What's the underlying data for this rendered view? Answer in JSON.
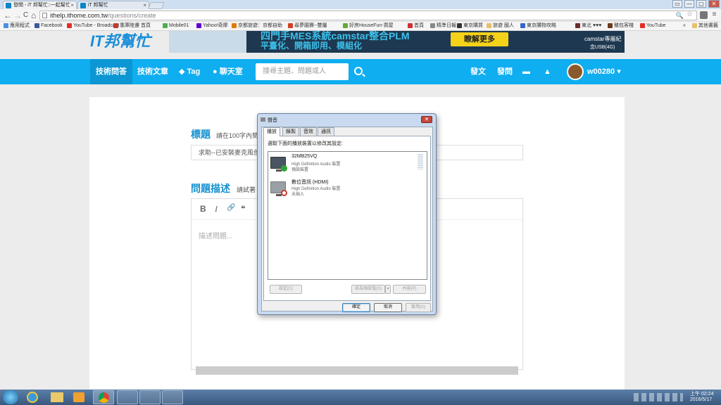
{
  "browser": {
    "tabs": [
      {
        "label": "發問 - iT 邦幫忙::一起幫忙",
        "close": "×"
      },
      {
        "label": "iT 邦幫忙",
        "close": "×"
      }
    ],
    "window_buttons": [
      "▭",
      "—",
      "▢",
      "✕"
    ],
    "nav": {
      "back": "←",
      "forward": "→",
      "reload": "C",
      "home": "⌂"
    },
    "address": {
      "host": "ithelp.ithome.com.tw",
      "path": "/questions/create",
      "zoom": "🔍",
      "star": "☆"
    },
    "menu": "≡",
    "bookmarks": [
      {
        "label": "應用程式",
        "color": "#4a90e2"
      },
      {
        "label": "Facebook",
        "color": "#3b5998"
      },
      {
        "label": "YouTube - Broadcast",
        "color": "#e52d27"
      },
      {
        "label": "重庫陸遷 首頁",
        "color": "#c23a2c"
      },
      {
        "label": "Mobile01",
        "color": "#4caf50"
      },
      {
        "label": "Yahoo!奇摩",
        "color": "#5f01d1"
      },
      {
        "label": "京都旅遊：京都自助",
        "color": "#e07b00"
      },
      {
        "label": "尋夢園賽--雙屬",
        "color": "#d04020"
      },
      {
        "label": "好房HouseFun-買屋",
        "color": "#66aa33"
      },
      {
        "label": "首頁",
        "color": "#d32f2f"
      },
      {
        "label": "精準日報",
        "color": "#888888"
      },
      {
        "label": "東京購買",
        "color": "#333333"
      },
      {
        "label": "旅遊 國人",
        "color": "#e8c16a"
      },
      {
        "label": "東京購物攻略",
        "color": "#3366cc"
      },
      {
        "label": "東北 ♥♥♥",
        "color": "#6b2c2c"
      },
      {
        "label": "豬包客棧",
        "color": "#6b3a1f"
      },
      {
        "label": "YouTube",
        "color": "#e52d27"
      }
    ],
    "bookmarks_overflow": "»",
    "other_bookmarks": "其他書籤"
  },
  "site": {
    "logo": "IT邦幫忙",
    "ad": {
      "line1": "四門手MES系統camstar整合PLM",
      "line2": "平臺化、開箱即用、模組化",
      "cta": "瞭解更多",
      "promo1": "camstar專屬紀",
      "promo2": "念USB(4G)"
    },
    "nav": {
      "items": [
        "技術問答",
        "技術文章",
        "Tag",
        "聊天室"
      ],
      "search_placeholder": "搜尋主題、問題或人",
      "right": [
        "發文",
        "發問"
      ],
      "user": "w00280"
    },
    "form": {
      "title_label": "標題",
      "title_hint": "請在100字內簡",
      "title_value": "求助--已安裝麥克風但",
      "desc_label": "問題描述",
      "desc_hint": "請試著",
      "toolbar": [
        "B",
        "I",
        "🔗",
        "❝"
      ],
      "editor_placeholder": "描述問題..."
    }
  },
  "dialog": {
    "title": "聲音",
    "close": "✕",
    "tabs": [
      "播放",
      "錄製",
      "音效",
      "通訊"
    ],
    "instruction": "選取下面的播放裝置以修改其設定:",
    "devices": [
      {
        "name": "32MB25VQ",
        "driver": "High Definition Audio 裝置",
        "status": "預設裝置"
      },
      {
        "name": "數位音訊 (HDMI)",
        "driver": "High Definition Audio 裝置",
        "status": "未插入"
      }
    ],
    "buttons": {
      "configure": "設定(C)",
      "set_default": "設為預設值(S)",
      "split": "▾",
      "properties": "內容(P)",
      "ok": "確定",
      "cancel": "取消",
      "apply": "套用(A)"
    }
  },
  "taskbar": {
    "clock_time": "上午 02:24",
    "clock_date": "2016/5/17"
  }
}
